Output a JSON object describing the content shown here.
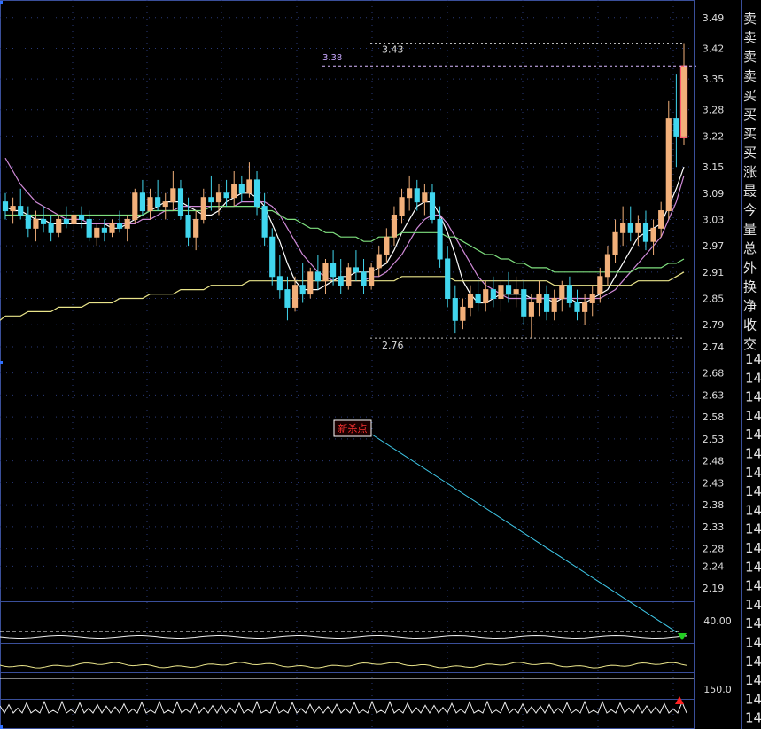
{
  "colors": {
    "background": "#000000",
    "frame": "#3a4f9a",
    "grid": "#2a3a7a",
    "up_candle": "#f2b07a",
    "down_candle": "#41d6ee",
    "ma_short": "#ffffff",
    "ma_mid": "#d08ad8",
    "ma_long": "#7fe07f",
    "ma_longest": "#e9e48a",
    "annotation_line": "#3fc8e8",
    "annotation_box_bg": "#ff0000",
    "signal_down": "#22cc22",
    "signal_up": "#ff2222"
  },
  "price_axis": {
    "ticks": [
      "3.49",
      "3.42",
      "3.35",
      "3.28",
      "3.22",
      "3.15",
      "3.09",
      "3.03",
      "2.97",
      "2.91",
      "2.85",
      "2.79",
      "2.74",
      "2.68",
      "2.63",
      "2.58",
      "2.53",
      "2.48",
      "2.43",
      "2.38",
      "2.33",
      "2.28",
      "2.24",
      "2.19"
    ]
  },
  "annotations": {
    "high_label": "3.43",
    "ref_label": "3.38",
    "low_label": "2.76",
    "signal_box": "新杀点"
  },
  "indicator_axis": {
    "panel1_tick": "40.00",
    "panel3_tick": "150.0"
  },
  "side_panel": {
    "labels": [
      "卖",
      "卖",
      "卖",
      "卖",
      "买",
      "买",
      "买",
      "买",
      "涨",
      "最",
      "今",
      "量",
      "总",
      "外",
      "换",
      "净",
      "收",
      "交"
    ],
    "time_prefix": "14"
  },
  "chart_data": {
    "type": "candlestick",
    "ylim": [
      2.16,
      3.53
    ],
    "price_high": 3.43,
    "price_low": 2.76,
    "reference_price": 3.38,
    "note_marker": "新杀点",
    "candles": [
      [
        3.07,
        3.09,
        3.03,
        3.05
      ],
      [
        3.05,
        3.08,
        3.02,
        3.06
      ],
      [
        3.06,
        3.1,
        3.03,
        3.04
      ],
      [
        3.04,
        3.06,
        2.99,
        3.01
      ],
      [
        3.01,
        3.05,
        2.98,
        3.03
      ],
      [
        3.03,
        3.06,
        3.0,
        3.02
      ],
      [
        3.02,
        3.04,
        2.98,
        3.0
      ],
      [
        3.0,
        3.04,
        2.99,
        3.03
      ],
      [
        3.03,
        3.06,
        3.01,
        3.02
      ],
      [
        3.02,
        3.05,
        2.99,
        3.04
      ],
      [
        3.04,
        3.06,
        3.01,
        3.03
      ],
      [
        3.03,
        3.05,
        2.98,
        2.99
      ],
      [
        2.99,
        3.02,
        2.97,
        3.01
      ],
      [
        3.01,
        3.03,
        2.98,
        3.0
      ],
      [
        3.0,
        3.03,
        2.99,
        3.02
      ],
      [
        3.02,
        3.05,
        3.0,
        3.01
      ],
      [
        3.01,
        3.04,
        2.98,
        3.03
      ],
      [
        3.03,
        3.1,
        3.02,
        3.09
      ],
      [
        3.09,
        3.12,
        3.04,
        3.05
      ],
      [
        3.05,
        3.1,
        3.03,
        3.08
      ],
      [
        3.08,
        3.12,
        3.05,
        3.06
      ],
      [
        3.06,
        3.09,
        3.03,
        3.07
      ],
      [
        3.07,
        3.14,
        3.05,
        3.1
      ],
      [
        3.1,
        3.12,
        3.03,
        3.04
      ],
      [
        3.04,
        3.08,
        2.97,
        2.99
      ],
      [
        2.99,
        3.05,
        2.96,
        3.03
      ],
      [
        3.03,
        3.1,
        3.02,
        3.08
      ],
      [
        3.08,
        3.13,
        3.05,
        3.07
      ],
      [
        3.07,
        3.11,
        3.04,
        3.09
      ],
      [
        3.09,
        3.12,
        3.06,
        3.08
      ],
      [
        3.08,
        3.14,
        3.06,
        3.11
      ],
      [
        3.11,
        3.13,
        3.07,
        3.09
      ],
      [
        3.09,
        3.16,
        3.08,
        3.12
      ],
      [
        3.12,
        3.14,
        3.04,
        3.06
      ],
      [
        3.06,
        3.09,
        2.97,
        2.99
      ],
      [
        2.99,
        3.01,
        2.88,
        2.9
      ],
      [
        2.9,
        2.95,
        2.85,
        2.87
      ],
      [
        2.87,
        2.9,
        2.8,
        2.83
      ],
      [
        2.83,
        2.9,
        2.82,
        2.88
      ],
      [
        2.88,
        2.93,
        2.84,
        2.86
      ],
      [
        2.86,
        2.92,
        2.85,
        2.91
      ],
      [
        2.91,
        2.95,
        2.87,
        2.89
      ],
      [
        2.89,
        2.94,
        2.86,
        2.93
      ],
      [
        2.93,
        2.96,
        2.88,
        2.9
      ],
      [
        2.9,
        2.94,
        2.86,
        2.88
      ],
      [
        2.88,
        2.93,
        2.87,
        2.92
      ],
      [
        2.92,
        2.96,
        2.89,
        2.91
      ],
      [
        2.91,
        2.94,
        2.86,
        2.88
      ],
      [
        2.88,
        2.93,
        2.87,
        2.92
      ],
      [
        2.92,
        2.97,
        2.9,
        2.95
      ],
      [
        2.95,
        3.01,
        2.93,
        2.99
      ],
      [
        2.99,
        3.06,
        2.97,
        3.04
      ],
      [
        3.04,
        3.1,
        3.02,
        3.08
      ],
      [
        3.08,
        3.13,
        3.05,
        3.1
      ],
      [
        3.1,
        3.12,
        3.05,
        3.07
      ],
      [
        3.07,
        3.11,
        3.04,
        3.09
      ],
      [
        3.09,
        3.11,
        3.02,
        3.03
      ],
      [
        3.03,
        3.06,
        2.92,
        2.94
      ],
      [
        2.94,
        2.97,
        2.83,
        2.85
      ],
      [
        2.85,
        2.88,
        2.77,
        2.8
      ],
      [
        2.8,
        2.85,
        2.78,
        2.83
      ],
      [
        2.83,
        2.88,
        2.81,
        2.86
      ],
      [
        2.86,
        2.9,
        2.82,
        2.84
      ],
      [
        2.84,
        2.89,
        2.82,
        2.87
      ],
      [
        2.87,
        2.9,
        2.83,
        2.85
      ],
      [
        2.85,
        2.89,
        2.82,
        2.88
      ],
      [
        2.88,
        2.91,
        2.84,
        2.86
      ],
      [
        2.86,
        2.9,
        2.83,
        2.87
      ],
      [
        2.87,
        2.89,
        2.79,
        2.81
      ],
      [
        2.81,
        2.86,
        2.76,
        2.84
      ],
      [
        2.84,
        2.89,
        2.81,
        2.86
      ],
      [
        2.86,
        2.88,
        2.8,
        2.82
      ],
      [
        2.82,
        2.87,
        2.8,
        2.85
      ],
      [
        2.85,
        2.89,
        2.82,
        2.88
      ],
      [
        2.88,
        2.9,
        2.83,
        2.84
      ],
      [
        2.84,
        2.87,
        2.8,
        2.82
      ],
      [
        2.82,
        2.86,
        2.79,
        2.84
      ],
      [
        2.84,
        2.88,
        2.81,
        2.86
      ],
      [
        2.86,
        2.92,
        2.84,
        2.9
      ],
      [
        2.9,
        2.97,
        2.88,
        2.95
      ],
      [
        2.95,
        3.03,
        2.93,
        3.0
      ],
      [
        3.0,
        3.06,
        2.97,
        3.02
      ],
      [
        3.02,
        3.06,
        2.98,
        3.0
      ],
      [
        3.0,
        3.04,
        2.97,
        3.02
      ],
      [
        3.02,
        3.05,
        2.96,
        2.98
      ],
      [
        2.98,
        3.03,
        2.95,
        3.01
      ],
      [
        3.01,
        3.07,
        2.99,
        3.05
      ],
      [
        3.05,
        3.3,
        3.03,
        3.26
      ],
      [
        3.26,
        3.36,
        3.15,
        3.22
      ],
      [
        3.22,
        3.43,
        3.2,
        3.38
      ]
    ],
    "ma": [
      {
        "name": "MA5",
        "color": "#ffffff",
        "values": [
          3.06,
          3.05,
          3.05,
          3.04,
          3.03,
          3.03,
          3.02,
          3.02,
          3.02,
          3.02,
          3.02,
          3.02,
          3.02,
          3.02,
          3.01,
          3.01,
          3.02,
          3.03,
          3.04,
          3.05,
          3.06,
          3.07,
          3.07,
          3.07,
          3.06,
          3.05,
          3.04,
          3.04,
          3.05,
          3.07,
          3.08,
          3.09,
          3.09,
          3.08,
          3.06,
          3.02,
          2.98,
          2.93,
          2.89,
          2.87,
          2.87,
          2.87,
          2.88,
          2.89,
          2.9,
          2.9,
          2.91,
          2.91,
          2.91,
          2.92,
          2.93,
          2.96,
          3.0,
          3.03,
          3.06,
          3.07,
          3.07,
          3.04,
          3.0,
          2.95,
          2.89,
          2.86,
          2.84,
          2.84,
          2.85,
          2.86,
          2.86,
          2.86,
          2.86,
          2.85,
          2.85,
          2.85,
          2.84,
          2.85,
          2.85,
          2.84,
          2.84,
          2.85,
          2.86,
          2.87,
          2.9,
          2.93,
          2.96,
          2.99,
          3.0,
          3.01,
          3.02,
          3.06,
          3.1,
          3.15
        ]
      },
      {
        "name": "MA10",
        "color": "#d08ad8",
        "values": [
          3.17,
          3.14,
          3.11,
          3.09,
          3.07,
          3.06,
          3.05,
          3.04,
          3.03,
          3.03,
          3.03,
          3.02,
          3.02,
          3.02,
          3.02,
          3.02,
          3.02,
          3.02,
          3.03,
          3.03,
          3.04,
          3.05,
          3.05,
          3.06,
          3.06,
          3.06,
          3.06,
          3.06,
          3.06,
          3.06,
          3.06,
          3.07,
          3.07,
          3.07,
          3.07,
          3.06,
          3.04,
          3.01,
          2.98,
          2.95,
          2.93,
          2.91,
          2.9,
          2.89,
          2.89,
          2.89,
          2.89,
          2.89,
          2.9,
          2.9,
          2.91,
          2.93,
          2.95,
          2.98,
          3.01,
          3.03,
          3.04,
          3.04,
          3.02,
          2.99,
          2.96,
          2.93,
          2.9,
          2.88,
          2.87,
          2.86,
          2.85,
          2.85,
          2.85,
          2.85,
          2.85,
          2.85,
          2.85,
          2.85,
          2.85,
          2.85,
          2.85,
          2.85,
          2.85,
          2.86,
          2.87,
          2.89,
          2.91,
          2.93,
          2.95,
          2.97,
          2.99,
          3.03,
          3.07,
          3.13
        ]
      },
      {
        "name": "MA30",
        "color": "#7fe07f",
        "values": [
          3.04,
          3.04,
          3.04,
          3.04,
          3.04,
          3.04,
          3.04,
          3.04,
          3.04,
          3.04,
          3.04,
          3.04,
          3.04,
          3.04,
          3.04,
          3.04,
          3.04,
          3.04,
          3.04,
          3.05,
          3.05,
          3.05,
          3.05,
          3.05,
          3.05,
          3.05,
          3.05,
          3.06,
          3.06,
          3.06,
          3.06,
          3.06,
          3.06,
          3.06,
          3.05,
          3.05,
          3.04,
          3.03,
          3.03,
          3.02,
          3.01,
          3.01,
          3.0,
          3.0,
          2.99,
          2.99,
          2.99,
          2.98,
          2.98,
          2.99,
          2.99,
          2.99,
          3.0,
          3.0,
          3.0,
          3.0,
          3.0,
          3.0,
          2.99,
          2.99,
          2.98,
          2.97,
          2.96,
          2.95,
          2.95,
          2.94,
          2.94,
          2.93,
          2.93,
          2.92,
          2.92,
          2.92,
          2.91,
          2.91,
          2.91,
          2.91,
          2.91,
          2.91,
          2.91,
          2.91,
          2.91,
          2.91,
          2.91,
          2.92,
          2.92,
          2.92,
          2.92,
          2.93,
          2.93,
          2.94
        ]
      },
      {
        "name": "MA60",
        "color": "#e9e48a",
        "values": [
          2.81,
          2.81,
          2.81,
          2.82,
          2.82,
          2.82,
          2.82,
          2.83,
          2.83,
          2.83,
          2.83,
          2.84,
          2.84,
          2.84,
          2.84,
          2.85,
          2.85,
          2.85,
          2.85,
          2.86,
          2.86,
          2.86,
          2.86,
          2.87,
          2.87,
          2.87,
          2.87,
          2.88,
          2.88,
          2.88,
          2.88,
          2.88,
          2.89,
          2.89,
          2.89,
          2.89,
          2.89,
          2.89,
          2.89,
          2.89,
          2.89,
          2.89,
          2.89,
          2.89,
          2.89,
          2.89,
          2.89,
          2.89,
          2.89,
          2.89,
          2.89,
          2.89,
          2.9,
          2.9,
          2.9,
          2.9,
          2.9,
          2.9,
          2.9,
          2.89,
          2.89,
          2.89,
          2.89,
          2.89,
          2.89,
          2.89,
          2.89,
          2.89,
          2.89,
          2.89,
          2.89,
          2.89,
          2.88,
          2.88,
          2.88,
          2.88,
          2.88,
          2.88,
          2.88,
          2.88,
          2.88,
          2.88,
          2.88,
          2.89,
          2.89,
          2.89,
          2.89,
          2.89,
          2.9,
          2.91
        ]
      }
    ]
  }
}
